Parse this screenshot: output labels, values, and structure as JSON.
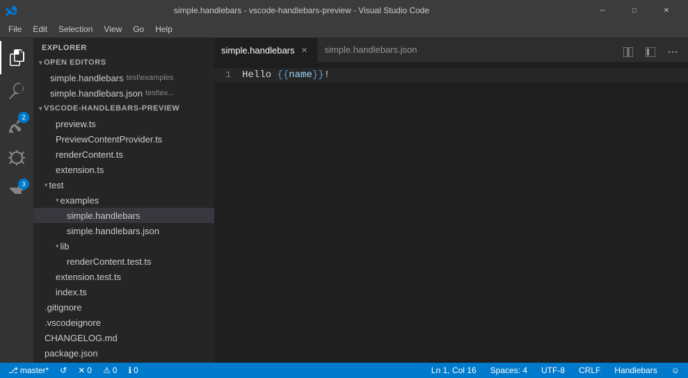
{
  "titleBar": {
    "icon": "vscode-icon",
    "title": "simple.handlebars - vscode-handlebars-preview - Visual Studio Code",
    "minimize": "─",
    "maximize": "□",
    "close": "✕"
  },
  "menuBar": {
    "items": [
      "File",
      "Edit",
      "Selection",
      "View",
      "Go",
      "Help"
    ]
  },
  "activityBar": {
    "icons": [
      {
        "name": "explorer-icon",
        "label": "Explorer",
        "active": true
      },
      {
        "name": "search-icon",
        "label": "Search"
      },
      {
        "name": "source-control-icon",
        "label": "Source Control",
        "badge": "2"
      },
      {
        "name": "debug-icon",
        "label": "Debug"
      },
      {
        "name": "extensions-icon",
        "label": "Extensions",
        "badge": "3"
      }
    ]
  },
  "sidebar": {
    "title": "EXPLORER",
    "sections": [
      {
        "name": "OPEN EDITORS",
        "items": [
          {
            "label": "simple.handlebars",
            "path": "test\\examples",
            "indent": 1,
            "active": false
          },
          {
            "label": "simple.handlebars.json",
            "path": "test\\ex...",
            "indent": 1,
            "active": false
          }
        ]
      },
      {
        "name": "VSCODE-HANDLEBARS-PREVIEW",
        "items": [
          {
            "label": "preview.ts",
            "indent": 2,
            "active": false
          },
          {
            "label": "PreviewContentProvider.ts",
            "indent": 2,
            "active": false
          },
          {
            "label": "renderContent.ts",
            "indent": 2,
            "active": false
          },
          {
            "label": "extension.ts",
            "indent": 2,
            "active": false
          },
          {
            "label": "test",
            "indent": 1,
            "isFolder": true,
            "active": false
          },
          {
            "label": "examples",
            "indent": 2,
            "isFolder": true,
            "active": false
          },
          {
            "label": "simple.handlebars",
            "indent": 3,
            "active": true
          },
          {
            "label": "simple.handlebars.json",
            "indent": 3,
            "active": false
          },
          {
            "label": "lib",
            "indent": 2,
            "isFolder": true,
            "active": false
          },
          {
            "label": "renderContent.test.ts",
            "indent": 3,
            "active": false
          },
          {
            "label": "extension.test.ts",
            "indent": 2,
            "active": false
          },
          {
            "label": "index.ts",
            "indent": 2,
            "active": false
          },
          {
            "label": ".gitignore",
            "indent": 1,
            "active": false
          },
          {
            "label": ".vscodeignore",
            "indent": 1,
            "active": false
          },
          {
            "label": "CHANGELOG.md",
            "indent": 1,
            "active": false
          },
          {
            "label": "package.json",
            "indent": 1,
            "active": false
          }
        ]
      }
    ]
  },
  "tabs": [
    {
      "label": "simple.handlebars",
      "active": true,
      "hasClose": true
    },
    {
      "label": "simple.handlebars.json",
      "active": false,
      "hasClose": false
    }
  ],
  "editor": {
    "lines": [
      {
        "number": "1",
        "content": "Hello {{name}}!"
      }
    ],
    "cursor": {
      "line": 1,
      "col": 16
    }
  },
  "statusBar": {
    "branch": "master*",
    "sync": "↺",
    "errors": "0",
    "warnings": "0",
    "infos": "0",
    "position": "Ln 1, Col 16",
    "spaces": "Spaces: 4",
    "encoding": "UTF-8",
    "lineEnding": "CRLF",
    "language": "Handlebars",
    "feedback": "☺"
  }
}
